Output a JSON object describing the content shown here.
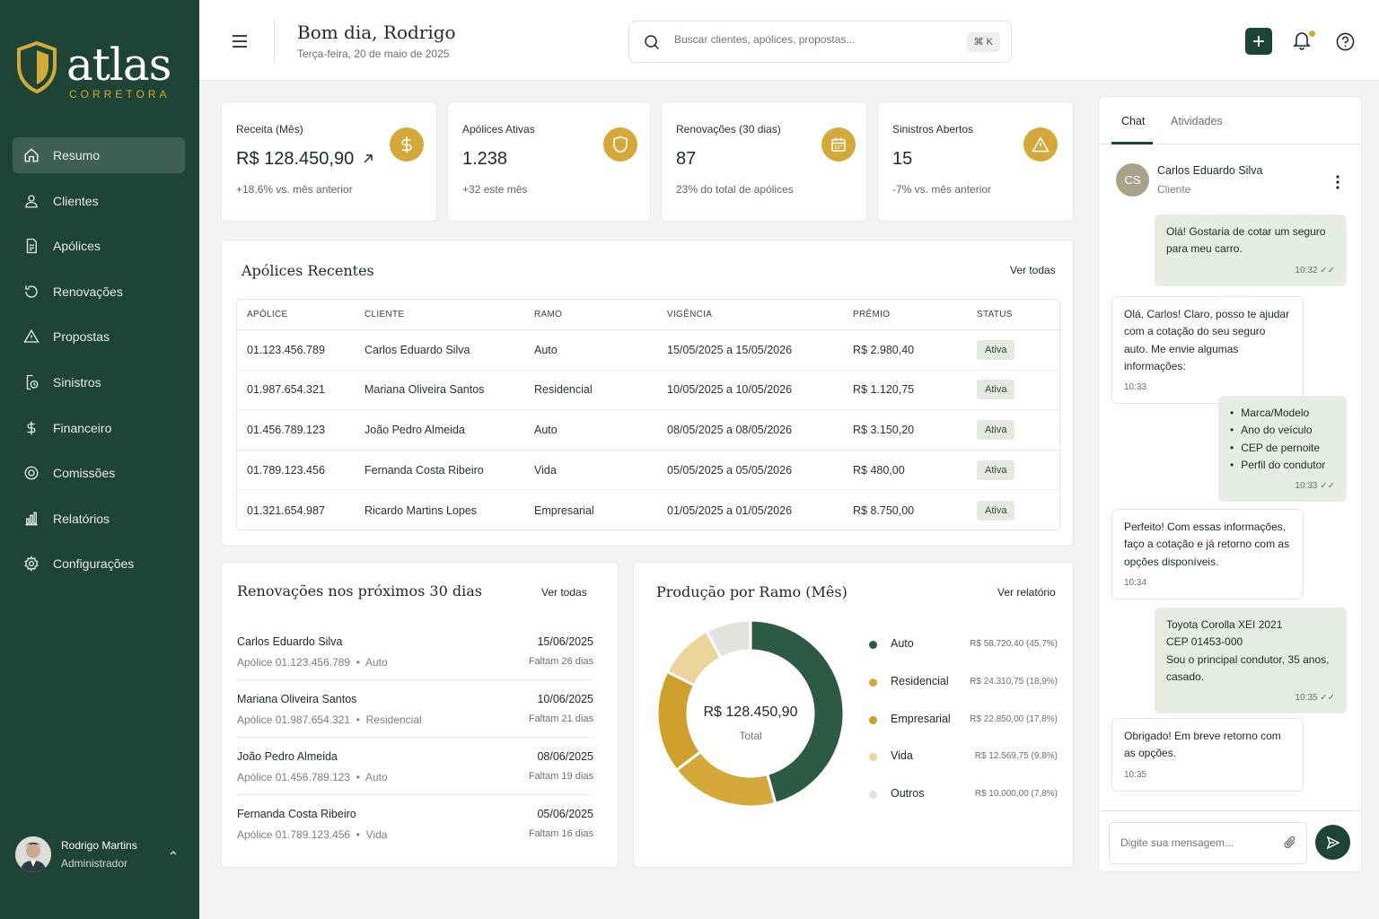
{
  "brand": {
    "name": "atlas",
    "subtitle": "CORRETORA",
    "accent": "#d4a93a",
    "primary": "#1d4434"
  },
  "sidebar": {
    "items": [
      {
        "label": "Resumo",
        "icon": "home-icon",
        "active": true
      },
      {
        "label": "Clientes",
        "icon": "user-icon"
      },
      {
        "label": "Apólices",
        "icon": "document-icon"
      },
      {
        "label": "Renovações",
        "icon": "refresh-icon"
      },
      {
        "label": "Propostas",
        "icon": "warning-icon"
      },
      {
        "label": "Sinistros",
        "icon": "file-clock-icon"
      },
      {
        "label": "Financeiro",
        "icon": "dollar-icon"
      },
      {
        "label": "Comissões",
        "icon": "target-icon"
      },
      {
        "label": "Relatórios",
        "icon": "chart-icon"
      },
      {
        "label": "Configurações",
        "icon": "gear-icon"
      }
    ],
    "user": {
      "name": "Rodrigo Martins",
      "role": "Administrador"
    }
  },
  "header": {
    "greeting": "Bom dia, Rodrigo",
    "date": "Terça-feira, 20 de maio de 2025",
    "search_placeholder": "Buscar clientes, apólices, propostas...",
    "shortcut": "⌘  K"
  },
  "kpis": [
    {
      "label": "Receita (Mês)",
      "value": "R$ 128.450,90",
      "sub": "+18,6% vs. mês anterior",
      "icon": "dollar-icon"
    },
    {
      "label": "Apólices Ativas",
      "value": "1.238",
      "sub": "+32 este mês",
      "icon": "shield-icon"
    },
    {
      "label": "Renovações (30 dias)",
      "value": "87",
      "sub": "23% do total de apólices",
      "icon": "calendar-icon"
    },
    {
      "label": "Sinistros Abertos",
      "value": "15",
      "sub": "-7% vs. mês anterior",
      "icon": "alert-icon"
    }
  ],
  "recent": {
    "title": "Apólices Recentes",
    "link": "Ver todas",
    "columns": [
      "APÓLICE",
      "CLIENTE",
      "RAMO",
      "VIGÊNCIA",
      "PRÊMIO",
      "STATUS"
    ],
    "rows": [
      [
        "01.123.456.789",
        "Carlos Eduardo Silva",
        "Auto",
        "15/05/2025 a 15/05/2026",
        "R$ 2.980,40",
        "Ativa"
      ],
      [
        "01.987.654.321",
        "Mariana Oliveira Santos",
        "Residencial",
        "10/05/2025 a 10/05/2026",
        "R$ 1.120,75",
        "Ativa"
      ],
      [
        "01.456.789.123",
        "João Pedro Almeida",
        "Auto",
        "08/05/2025 a 08/05/2026",
        "R$ 3.150,20",
        "Ativa"
      ],
      [
        "01.789.123.456",
        "Fernanda Costa Ribeiro",
        "Vida",
        "05/05/2025 a 05/05/2026",
        "R$ 480,00",
        "Ativa"
      ],
      [
        "01.321.654.987",
        "Ricardo Martins Lopes",
        "Empresarial",
        "01/05/2025 a 01/05/2026",
        "R$ 8.750,00",
        "Ativa"
      ]
    ]
  },
  "renewals": {
    "title": "Renovações nos próximos 30 dias",
    "link": "Ver todas",
    "items": [
      {
        "name": "Carlos Eduardo Silva",
        "policy": "Apólice 01.123.456.789",
        "ramo": "Auto",
        "date": "15/06/2025",
        "left": "Faltam 26 dias"
      },
      {
        "name": "Mariana Oliveira Santos",
        "policy": "Apólice 01.987.654.321",
        "ramo": "Residencial",
        "date": "10/06/2025",
        "left": "Faltam 21 dias"
      },
      {
        "name": "João Pedro Almeida",
        "policy": "Apólice 01.456.789.123",
        "ramo": "Auto",
        "date": "08/06/2025",
        "left": "Faltam 19 dias"
      },
      {
        "name": "Fernanda Costa Ribeiro",
        "policy": "Apólice 01.789.123.456",
        "ramo": "Vida",
        "date": "05/06/2025",
        "left": "Faltam 16 dias"
      }
    ]
  },
  "production": {
    "title": "Produção por Ramo (Mês)",
    "link": "Ver relatório",
    "center_value": "R$ 128.450,90",
    "center_label": "Total"
  },
  "chart_data": {
    "type": "pie",
    "categories": [
      "Auto",
      "Residencial",
      "Empresarial",
      "Vida",
      "Outros"
    ],
    "values": [
      45.7,
      18.9,
      17.8,
      9.8,
      7.8
    ],
    "labels": [
      "R$ 58.720,40 (45,7%)",
      "R$ 24.310,75 (18,9%)",
      "R$ 22.850,00 (17,8%)",
      "R$ 12.569,75 (9,8%)",
      "R$ 10.000,00 (7,8%)"
    ],
    "colors": [
      "#2d5a45",
      "#d4a93a",
      "#cf9f2c",
      "#ecd59a",
      "#e2e2de"
    ],
    "legend": "right"
  },
  "chat": {
    "tabs": [
      "Chat",
      "Atividades"
    ],
    "contact": {
      "initials": "CS",
      "name": "Carlos Eduardo Silva",
      "role": "Cliente"
    },
    "messages": [
      {
        "from": "out",
        "text": "Olá! Gostaria de cotar um seguro para meu carro.",
        "time": "10:32"
      },
      {
        "from": "in",
        "text": "Olá, Carlos! Claro, posso te ajudar com a cotação do seu seguro auto. Me envie algumas informações:",
        "time": "10:33"
      },
      {
        "from": "out",
        "list": [
          "Marca/Modelo",
          "Ano do veículo",
          "CEP de pernoite",
          "Perfil do condutor"
        ],
        "time": "10:33"
      },
      {
        "from": "in",
        "text": "Perfeito! Com essas informações, faço a cotação e já retorno com as opções disponíveis.",
        "time": "10:34"
      },
      {
        "from": "out",
        "lines": [
          "Toyota Corolla XEI 2021",
          "CEP 01453-000",
          "Sou o principal condutor, 35 anos, casado."
        ],
        "time": "10:35"
      },
      {
        "from": "in",
        "text": "Obrigado! Em breve retorno com as opções.",
        "time": "10:35"
      }
    ],
    "input_placeholder": "Digite sua mensagem..."
  }
}
